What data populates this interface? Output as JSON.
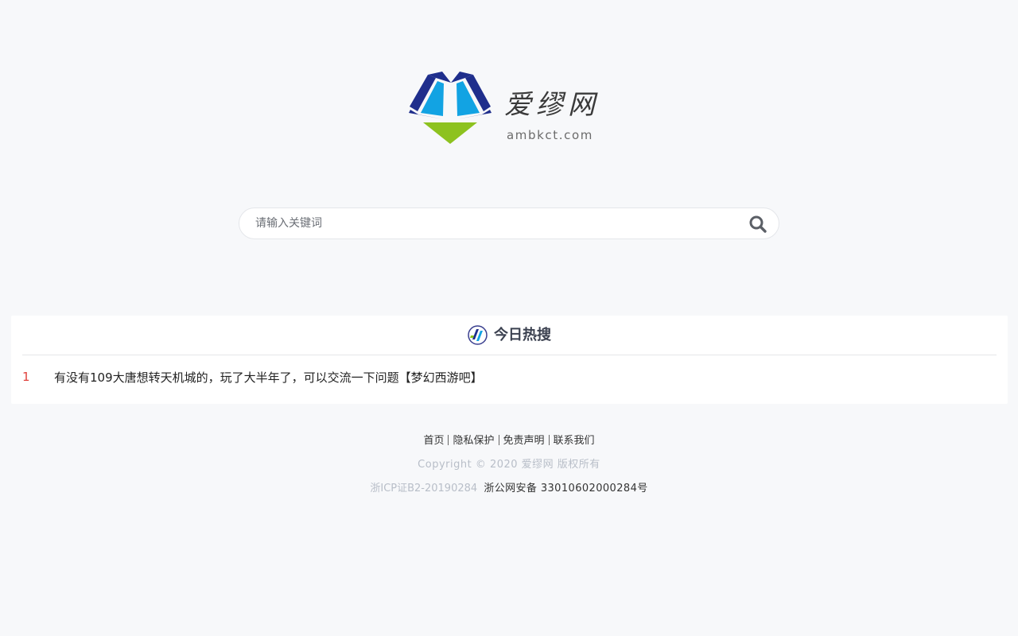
{
  "logo": {
    "name": "爱缪网",
    "domain": "ambkct.com",
    "colors": {
      "dark_blue": "#1f2e8c",
      "light_blue": "#12a3e3",
      "green": "#8dc21f"
    }
  },
  "search": {
    "placeholder": "请输入关键词",
    "value": "",
    "icon": "search-icon"
  },
  "hot": {
    "title": "今日热搜",
    "icon": "hot-logo-icon",
    "items": [
      {
        "rank": "1",
        "text": "有没有109大唐想转天机城的，玩了大半年了，可以交流一下问题【梦幻西游吧】"
      }
    ]
  },
  "footer": {
    "links": [
      {
        "label": "首页"
      },
      {
        "label": "隐私保护"
      },
      {
        "label": "免责声明"
      },
      {
        "label": "联系我们"
      }
    ],
    "copyright": "Copyright © 2020 爱缪网 版权所有",
    "icp": "浙ICP证B2-20190284",
    "police": "浙公网安备 33010602000284号"
  },
  "colors": {
    "background": "#f7f8fa",
    "rank": "#e0413c",
    "muted": "#b8bec8"
  }
}
